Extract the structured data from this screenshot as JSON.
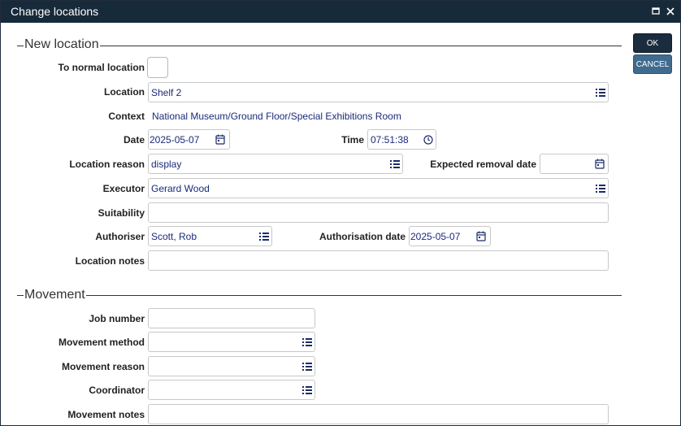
{
  "window": {
    "title": "Change locations",
    "maximize_icon": "maximize-icon",
    "close_icon": "close-icon"
  },
  "buttons": {
    "ok": "OK",
    "cancel": "CANCEL"
  },
  "sections": {
    "new_location": "New location",
    "movement": "Movement"
  },
  "new_location": {
    "to_normal_location": {
      "label": "To normal location",
      "checked": false
    },
    "location": {
      "label": "Location",
      "value": "Shelf 2"
    },
    "context": {
      "label": "Context",
      "value": "National Museum/Ground Floor/Special Exhibitions Room"
    },
    "date": {
      "label": "Date",
      "value": "2025-05-07"
    },
    "time": {
      "label": "Time",
      "value": "07:51:38"
    },
    "location_reason": {
      "label": "Location reason",
      "value": "display"
    },
    "expected_removal_date": {
      "label": "Expected removal date",
      "value": ""
    },
    "executor": {
      "label": "Executor",
      "value": "Gerard Wood"
    },
    "suitability": {
      "label": "Suitability",
      "value": ""
    },
    "authoriser": {
      "label": "Authoriser",
      "value": "Scott, Rob"
    },
    "authorisation_date": {
      "label": "Authorisation date",
      "value": "2025-05-07"
    },
    "location_notes": {
      "label": "Location notes",
      "value": ""
    }
  },
  "movement": {
    "job_number": {
      "label": "Job number",
      "value": ""
    },
    "movement_method": {
      "label": "Movement method",
      "value": ""
    },
    "movement_reason": {
      "label": "Movement reason",
      "value": ""
    },
    "coordinator": {
      "label": "Coordinator",
      "value": ""
    },
    "movement_notes": {
      "label": "Movement notes",
      "value": ""
    }
  },
  "colors": {
    "titlebar": "#172a3a",
    "value_text": "#1b2a7a",
    "cancel_button": "#3f6b8f"
  }
}
